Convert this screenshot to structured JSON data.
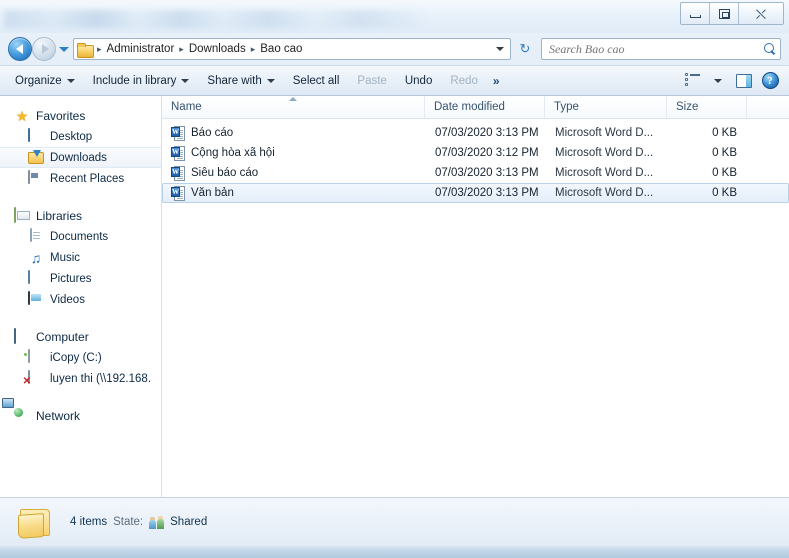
{
  "window": {
    "controls": {
      "minimize": "minimize",
      "maximize": "restore",
      "close": "close"
    }
  },
  "address_bar": {
    "back_label": "Back",
    "forward_label": "Forward",
    "history_label": "Recent pages",
    "folder_icon": "folder-icon",
    "crumbs": [
      "Administrator",
      "Downloads",
      "Bao cao"
    ],
    "separator": "▸",
    "refresh_label": "Refresh"
  },
  "search": {
    "placeholder": "Search Bao cao",
    "value": "",
    "icon": "search-icon"
  },
  "toolbar": {
    "items": [
      {
        "label": "Organize",
        "has_caret": true,
        "disabled": false
      },
      {
        "label": "Include in library",
        "has_caret": true,
        "disabled": false
      },
      {
        "label": "Share with",
        "has_caret": true,
        "disabled": false
      },
      {
        "label": "Select all",
        "has_caret": false,
        "disabled": false
      },
      {
        "label": "Paste",
        "has_caret": false,
        "disabled": true
      },
      {
        "label": "Undo",
        "has_caret": false,
        "disabled": false
      },
      {
        "label": "Redo",
        "has_caret": false,
        "disabled": true
      }
    ],
    "overflow": "»",
    "views_icon": "view-options-icon",
    "preview_icon": "preview-pane-icon",
    "help_icon": "help-icon",
    "help_glyph": "?"
  },
  "sidebar": {
    "groups": [
      {
        "header": {
          "label": "Favorites",
          "icon": "star-icon"
        },
        "items": [
          {
            "label": "Desktop",
            "icon": "desktop-icon",
            "selected": false
          },
          {
            "label": "Downloads",
            "icon": "downloads-icon",
            "selected": true
          },
          {
            "label": "Recent Places",
            "icon": "recent-places-icon",
            "selected": false
          }
        ]
      },
      {
        "header": {
          "label": "Libraries",
          "icon": "libraries-icon"
        },
        "items": [
          {
            "label": "Documents",
            "icon": "documents-icon",
            "selected": false
          },
          {
            "label": "Music",
            "icon": "music-icon",
            "selected": false
          },
          {
            "label": "Pictures",
            "icon": "pictures-icon",
            "selected": false
          },
          {
            "label": "Videos",
            "icon": "videos-icon",
            "selected": false
          }
        ]
      },
      {
        "header": {
          "label": "Computer",
          "icon": "computer-icon"
        },
        "items": [
          {
            "label": "iCopy (C:)",
            "icon": "hard-drive-icon",
            "selected": false
          },
          {
            "label": "luyen thi (\\\\192.168.",
            "icon": "network-drive-disconnected-icon",
            "selected": false
          }
        ]
      },
      {
        "header": {
          "label": "Network",
          "icon": "network-icon"
        },
        "items": []
      }
    ]
  },
  "file_list": {
    "columns": [
      {
        "key": "name",
        "label": "Name",
        "sorted": "asc"
      },
      {
        "key": "date",
        "label": "Date modified",
        "sorted": ""
      },
      {
        "key": "type",
        "label": "Type",
        "sorted": ""
      },
      {
        "key": "size",
        "label": "Size",
        "sorted": ""
      }
    ],
    "rows": [
      {
        "name": "Báo cáo",
        "date": "07/03/2020 3:13 PM",
        "type": "Microsoft Word D...",
        "size": "0 KB",
        "icon": "word-document-icon",
        "selected": false
      },
      {
        "name": "Cộng hòa xã hội",
        "date": "07/03/2020 3:12 PM",
        "type": "Microsoft Word D...",
        "size": "0 KB",
        "icon": "word-document-icon",
        "selected": false
      },
      {
        "name": "Siêu báo cáo",
        "date": "07/03/2020 3:13 PM",
        "type": "Microsoft Word D...",
        "size": "0 KB",
        "icon": "word-document-icon",
        "selected": false
      },
      {
        "name": "Văn bản",
        "date": "07/03/2020 3:13 PM",
        "type": "Microsoft Word D...",
        "size": "0 KB",
        "icon": "word-document-icon",
        "selected": true
      }
    ]
  },
  "status_bar": {
    "folder_icon": "open-folder-icon",
    "item_count": "4 items",
    "state_label": "State:",
    "share_icon": "shared-users-icon",
    "share_value": "Shared"
  }
}
